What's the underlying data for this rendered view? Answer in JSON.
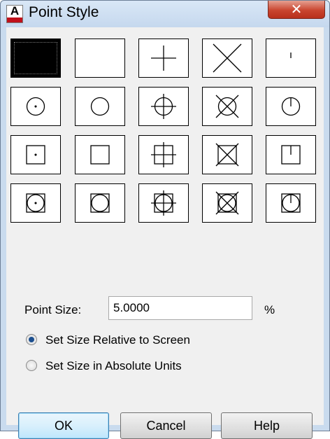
{
  "window": {
    "title": "Point Style",
    "app_icon_letter": "A"
  },
  "styles": [
    "none-selected",
    "blank",
    "plus",
    "x",
    "tick",
    "circle-dot",
    "circle",
    "circle-plus",
    "circle-x",
    "circle-tick",
    "square-dot",
    "square",
    "square-plus",
    "square-x",
    "square-tick",
    "square-circle-dot",
    "square-circle",
    "square-circle-plus",
    "square-circle-x",
    "square-circle-tick"
  ],
  "selected_index": 0,
  "point_size": {
    "label": "Point Size:",
    "value": "5.0000",
    "unit": "%"
  },
  "size_mode": {
    "options": [
      "Set Size Relative to Screen",
      "Set Size in Absolute Units"
    ],
    "selected": 0
  },
  "buttons": {
    "ok": "OK",
    "cancel": "Cancel",
    "help": "Help"
  },
  "icons": {
    "close": "close-icon",
    "app": "autocad-app-icon"
  }
}
